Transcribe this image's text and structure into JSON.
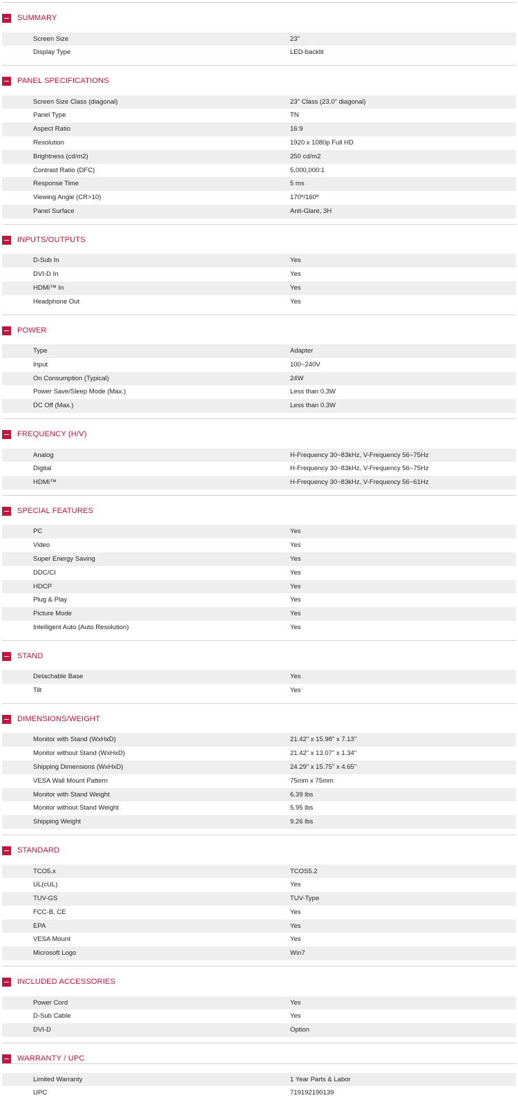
{
  "theme": {
    "accent": "#c5133d",
    "stripe": "#eeeeee",
    "rule": "#d4d4d4"
  },
  "toggle_icon": "minus-square-icon",
  "sections": [
    {
      "title": "SUMMARY",
      "rows": [
        {
          "label": "Screen Size",
          "value": "23\""
        },
        {
          "label": "Display Type",
          "value": "LED-backlit"
        }
      ]
    },
    {
      "title": "PANEL SPECIFICATIONS",
      "rows": [
        {
          "label": "Screen Size Class (diagonal)",
          "value": "23\" Class (23.0\" diagonal)"
        },
        {
          "label": "Panel Type",
          "value": "TN"
        },
        {
          "label": "Aspect Ratio",
          "value": "16:9"
        },
        {
          "label": "Resolution",
          "value": "1920 x 1080p Full HD"
        },
        {
          "label": "Brightness (cd/m2)",
          "value": "250 cd/m2"
        },
        {
          "label": "Contrast Ratio (DFC)",
          "value": "5,000,000:1"
        },
        {
          "label": "Response Time",
          "value": "5 ms"
        },
        {
          "label": "Viewing Angle (CR>10)",
          "value": "170º/160º"
        },
        {
          "label": "Panel Surface",
          "value": "Anti-Glare, 3H"
        }
      ]
    },
    {
      "title": "INPUTS/OUTPUTS",
      "rows": [
        {
          "label": "D-Sub In",
          "value": "Yes"
        },
        {
          "label": "DVI-D In",
          "value": "Yes"
        },
        {
          "label": "HDMI™ In",
          "value": "Yes"
        },
        {
          "label": "Headphone Out",
          "value": "Yes"
        }
      ]
    },
    {
      "title": "POWER",
      "rows": [
        {
          "label": "Type",
          "value": "Adapter"
        },
        {
          "label": "Input",
          "value": "100~240V"
        },
        {
          "label": "On Consumption (Typical)",
          "value": "24W"
        },
        {
          "label": "Power Save/Sleep Mode (Max.)",
          "value": "Less than 0.3W"
        },
        {
          "label": "DC Off (Max.)",
          "value": "Less than 0.3W"
        }
      ]
    },
    {
      "title": "FREQUENCY (H/V)",
      "rows": [
        {
          "label": "Analog",
          "value": "H-Frequency 30~83kHz, V-Frequency 56~75Hz"
        },
        {
          "label": "Digital",
          "value": "H-Frequency 30~83kHz, V-Frequency 56~75Hz"
        },
        {
          "label": "HDMI™",
          "value": "H-Frequency 30~83kHz, V-Frequency 56~61Hz"
        }
      ]
    },
    {
      "title": "SPECIAL FEATURES",
      "rows": [
        {
          "label": "PC",
          "value": "Yes"
        },
        {
          "label": "Video",
          "value": "Yes"
        },
        {
          "label": "Super Energy Saving",
          "value": "Yes"
        },
        {
          "label": "DDC/CI",
          "value": "Yes"
        },
        {
          "label": "HDCP",
          "value": "Yes"
        },
        {
          "label": "Plug & Play",
          "value": "Yes"
        },
        {
          "label": "Picture Mode",
          "value": "Yes"
        },
        {
          "label": "Intelligent Auto (Auto Resolution)",
          "value": "Yes"
        }
      ]
    },
    {
      "title": "STAND",
      "rows": [
        {
          "label": "Detachable Base",
          "value": "Yes"
        },
        {
          "label": "Tilt",
          "value": "Yes"
        }
      ]
    },
    {
      "title": "DIMENSIONS/WEIGHT",
      "rows": [
        {
          "label": "Monitor with Stand (WxHxD)",
          "value": "21.42\" x 15.98\" x 7.13\""
        },
        {
          "label": "Monitor without Stand (WxHxD)",
          "value": "21.42\" x 13.07\" x 1.34\""
        },
        {
          "label": "Shipping Dimensions (WxHxD)",
          "value": "24.29\" x 15.75\" x 4.65\""
        },
        {
          "label": "VESA Wall Mount Pattern",
          "value": "75mm x 75mm"
        },
        {
          "label": "Monitor with Stand Weight",
          "value": "6.39 lbs"
        },
        {
          "label": "Monitor without Stand Weight",
          "value": "5.95 lbs"
        },
        {
          "label": "Shipping Weight",
          "value": "9.26 lbs"
        }
      ]
    },
    {
      "title": "STANDARD",
      "rows": [
        {
          "label": "TCO5.x",
          "value": "TCOS5.2"
        },
        {
          "label": "UL(cUL)",
          "value": "Yes"
        },
        {
          "label": "TUV-GS",
          "value": "TUV-Type"
        },
        {
          "label": "FCC-B, CE",
          "value": "Yes"
        },
        {
          "label": "EPA",
          "value": "Yes"
        },
        {
          "label": "VESA Mount",
          "value": "Yes"
        },
        {
          "label": "Microsoft Logo",
          "value": "Win7"
        }
      ]
    },
    {
      "title": "INCLUDED ACCESSORIES",
      "rows": [
        {
          "label": "Power Cord",
          "value": "Yes"
        },
        {
          "label": "D-Sub Cable",
          "value": "Yes"
        },
        {
          "label": "DVI-D",
          "value": "Option"
        }
      ]
    },
    {
      "title": "WARRANTY / UPC",
      "rows": [
        {
          "label": "Limited Warranty",
          "value": "1 Year Parts & Labor"
        },
        {
          "label": "UPC",
          "value": "719192190139"
        }
      ]
    }
  ]
}
